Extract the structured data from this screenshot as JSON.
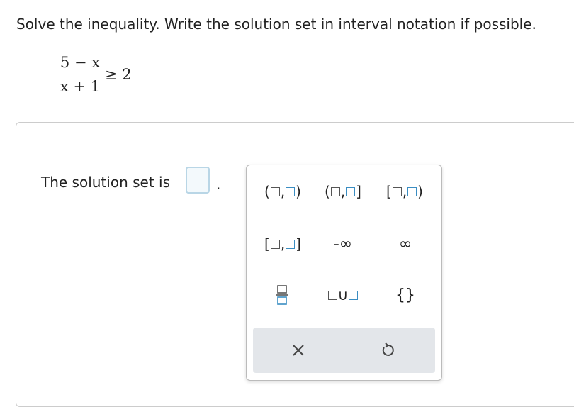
{
  "question": {
    "prompt": "Solve the inequality. Write the solution set in interval notation if possible.",
    "numerator": "5 − x",
    "denominator": "x + 1",
    "relation": "≥ 2"
  },
  "answer": {
    "label": "The solution set is",
    "value": "",
    "period": "."
  },
  "palette": {
    "row1": [
      "(□,□)",
      "(□,□]",
      "[□,□)"
    ],
    "row2": [
      "[□,□]",
      "-∞",
      "∞"
    ],
    "row3": [
      "fraction",
      "□∪□",
      "{}"
    ],
    "neg_inf": "-∞",
    "inf": "∞",
    "union": "∪",
    "braces": "{}",
    "clear_icon": "close-icon",
    "undo_icon": "undo-icon"
  }
}
